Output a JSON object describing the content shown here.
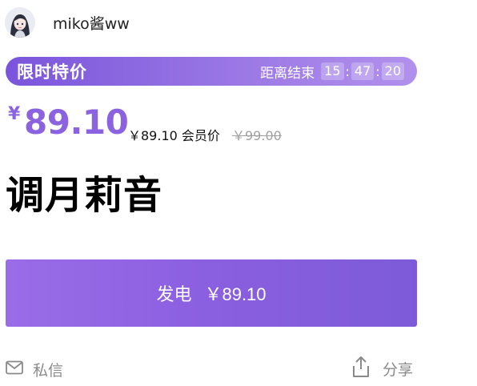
{
  "author": {
    "name": "miko酱ww",
    "avatar_icon": "user-avatar-anime"
  },
  "promo": {
    "title": "限时特价",
    "countdown_label": "距离结束",
    "hours": "15",
    "minutes": "47",
    "seconds": "20",
    "separator": ":"
  },
  "price": {
    "currency": "¥",
    "amount": "89.10",
    "member_price": "￥89.10 会员价",
    "original_price": "￥99.00",
    "accent_color": "#8b63e0"
  },
  "product": {
    "title": "调月莉音"
  },
  "buy_button": {
    "label": "发电",
    "price": "￥89.10"
  },
  "actions": {
    "message_label": "私信",
    "message_icon": "mail-icon",
    "share_label": "分享",
    "share_icon": "share-icon"
  }
}
